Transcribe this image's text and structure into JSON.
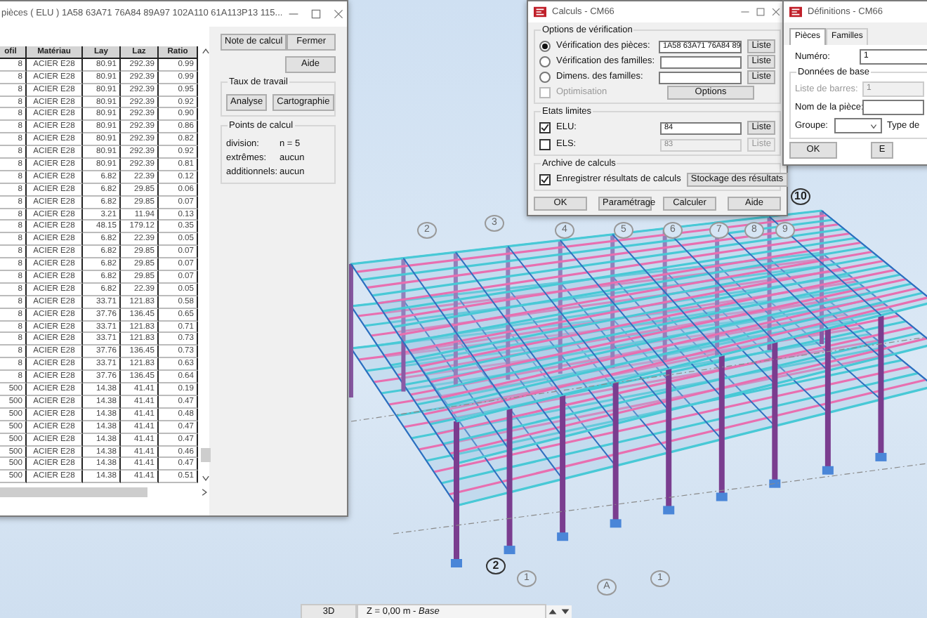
{
  "table_window": {
    "title": "pièces ( ELU ) 1A58 63A71 76A84 89A97 102A110 61A113P13 115...",
    "columns": [
      "ofil",
      "Matériau",
      "Lay",
      "Laz",
      "Ratio"
    ],
    "rows": [
      [
        "8",
        "ACIER E28",
        "80.91",
        "292.39",
        "0.99"
      ],
      [
        "8",
        "ACIER E28",
        "80.91",
        "292.39",
        "0.99"
      ],
      [
        "8",
        "ACIER E28",
        "80.91",
        "292.39",
        "0.95"
      ],
      [
        "8",
        "ACIER E28",
        "80.91",
        "292.39",
        "0.92"
      ],
      [
        "8",
        "ACIER E28",
        "80.91",
        "292.39",
        "0.90"
      ],
      [
        "8",
        "ACIER E28",
        "80.91",
        "292.39",
        "0.86"
      ],
      [
        "8",
        "ACIER E28",
        "80.91",
        "292.39",
        "0.82"
      ],
      [
        "8",
        "ACIER E28",
        "80.91",
        "292.39",
        "0.92"
      ],
      [
        "8",
        "ACIER E28",
        "80.91",
        "292.39",
        "0.81"
      ],
      [
        "8",
        "ACIER E28",
        "6.82",
        "22.39",
        "0.12"
      ],
      [
        "8",
        "ACIER E28",
        "6.82",
        "29.85",
        "0.06"
      ],
      [
        "8",
        "ACIER E28",
        "6.82",
        "29.85",
        "0.07"
      ],
      [
        "8",
        "ACIER E28",
        "3.21",
        "11.94",
        "0.13"
      ],
      [
        "8",
        "ACIER E28",
        "48.15",
        "179.12",
        "0.35"
      ],
      [
        "8",
        "ACIER E28",
        "6.82",
        "22.39",
        "0.05"
      ],
      [
        "8",
        "ACIER E28",
        "6.82",
        "29.85",
        "0.07"
      ],
      [
        "8",
        "ACIER E28",
        "6.82",
        "29.85",
        "0.07"
      ],
      [
        "8",
        "ACIER E28",
        "6.82",
        "29.85",
        "0.07"
      ],
      [
        "8",
        "ACIER E28",
        "6.82",
        "22.39",
        "0.05"
      ],
      [
        "8",
        "ACIER E28",
        "33.71",
        "121.83",
        "0.58"
      ],
      [
        "8",
        "ACIER E28",
        "37.76",
        "136.45",
        "0.65"
      ],
      [
        "8",
        "ACIER E28",
        "33.71",
        "121.83",
        "0.71"
      ],
      [
        "8",
        "ACIER E28",
        "33.71",
        "121.83",
        "0.73"
      ],
      [
        "8",
        "ACIER E28",
        "37.76",
        "136.45",
        "0.73"
      ],
      [
        "8",
        "ACIER E28",
        "33.71",
        "121.83",
        "0.63"
      ],
      [
        "8",
        "ACIER E28",
        "37.76",
        "136.45",
        "0.64"
      ],
      [
        "500",
        "ACIER E28",
        "14.38",
        "41.41",
        "0.19"
      ],
      [
        "500",
        "ACIER E28",
        "14.38",
        "41.41",
        "0.47"
      ],
      [
        "500",
        "ACIER E28",
        "14.38",
        "41.41",
        "0.48"
      ],
      [
        "500",
        "ACIER E28",
        "14.38",
        "41.41",
        "0.47"
      ],
      [
        "500",
        "ACIER E28",
        "14.38",
        "41.41",
        "0.47"
      ],
      [
        "500",
        "ACIER E28",
        "14.38",
        "41.41",
        "0.46"
      ],
      [
        "500",
        "ACIER E28",
        "14.38",
        "41.41",
        "0.47"
      ],
      [
        "500",
        "ACIER E28",
        "14.38",
        "41.41",
        "0.51"
      ]
    ],
    "buttons": [
      "Note de calcul",
      "Fermer",
      "Aide"
    ],
    "taux_de_travail": {
      "title": "Taux de travail",
      "buttons": [
        "Analyse",
        "Cartographie"
      ]
    },
    "points_de_calcul": {
      "title": "Points de calcul",
      "fields": [
        {
          "label": "division:",
          "value": "n = 5"
        },
        {
          "label": "extrêmes:",
          "value": "aucun"
        },
        {
          "label": "additionnels:",
          "value": "aucun"
        }
      ]
    }
  },
  "calc_dialog": {
    "title": "Calculs - CM66",
    "options": {
      "title": "Options de vérification",
      "choices": [
        {
          "label": "Vérification des pièces:",
          "selected": true,
          "value": "1A58 63A71 76A84 89",
          "button": "Liste"
        },
        {
          "label": "Vérification des familles:",
          "selected": false,
          "button": "Liste"
        },
        {
          "label": "Dimens. des familles:",
          "selected": false,
          "button": "Liste"
        }
      ],
      "optimisation": {
        "label": "Optimisation",
        "checked": false,
        "disabled": true
      },
      "options_button": "Options"
    },
    "etats_limites": {
      "title": "Etats limites",
      "items": [
        {
          "label": "ELU:",
          "checked": true,
          "value": "84",
          "button": "Liste",
          "disabled": false
        },
        {
          "label": "ELS:",
          "checked": false,
          "value": "83",
          "button": "Liste",
          "disabled": true
        }
      ]
    },
    "archive": {
      "title": "Archive de calculs",
      "save": {
        "label": "Enregistrer résultats de calculs",
        "checked": true
      },
      "button": "Stockage des résultats"
    },
    "buttons": [
      "OK",
      "Paramétrage",
      "Calculer",
      "Aide"
    ]
  },
  "definitions_dialog": {
    "title": "Définitions - CM66",
    "tabs": [
      {
        "label": "Pièces",
        "selected": true
      },
      {
        "label": "Familles",
        "selected": false
      }
    ],
    "numero": {
      "label": "Numéro:",
      "value": "1"
    },
    "group_title": "Données de base",
    "fields": [
      {
        "label": "Liste de barres:",
        "value": "1",
        "disabled": true
      },
      {
        "label": "Nom de la pièce:",
        "disabled": false
      }
    ],
    "groupe": {
      "label": "Groupe:"
    },
    "type_label": "Type de",
    "buttons": [
      "OK",
      "E"
    ]
  },
  "viewport": {
    "grid_markers": [
      {
        "label": "2",
        "emphasized": false
      },
      {
        "label": "3",
        "emphasized": false
      },
      {
        "label": "4",
        "emphasized": false
      },
      {
        "label": "5",
        "emphasized": false
      },
      {
        "label": "6",
        "emphasized": false
      },
      {
        "label": "7",
        "emphasized": false
      },
      {
        "label": "8",
        "emphasized": false
      },
      {
        "label": "9",
        "emphasized": false
      },
      {
        "label": "10",
        "emphasized": true
      },
      {
        "label": "2",
        "emphasized": true
      },
      {
        "label": "1",
        "emphasized": false
      },
      {
        "label": "A",
        "emphasized": false
      },
      {
        "label": "1",
        "emphasized": false
      }
    ]
  },
  "view_bar": {
    "mode": "3D",
    "plane": "Z = 0,00 m - *Base*"
  }
}
